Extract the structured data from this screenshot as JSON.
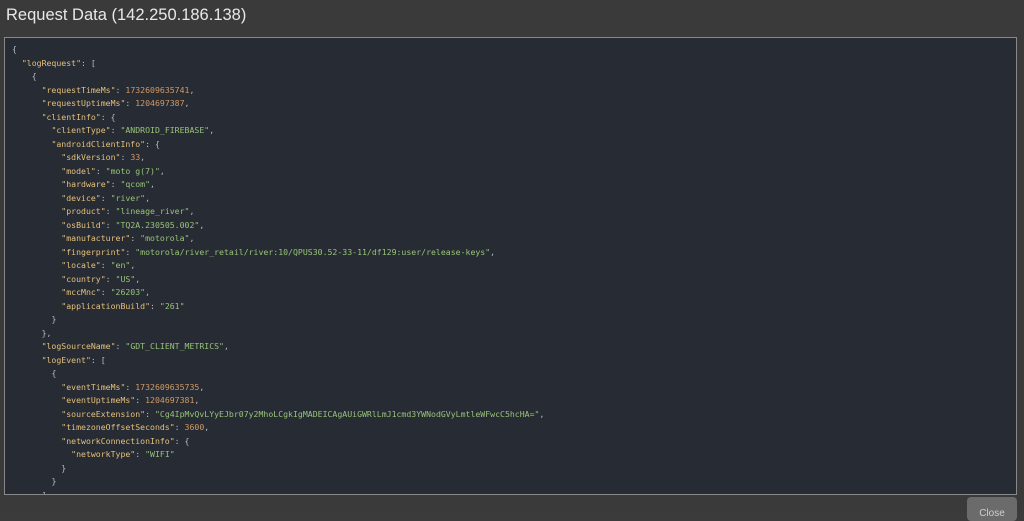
{
  "dialog": {
    "title": "Request Data (142.250.186.138)",
    "close_label": "Close"
  },
  "json_lines": [
    {
      "indent": 0,
      "tokens": [
        {
          "t": "p",
          "v": "{"
        }
      ]
    },
    {
      "indent": 1,
      "tokens": [
        {
          "t": "k",
          "v": "\"logRequest\""
        },
        {
          "t": "p",
          "v": ": ["
        }
      ]
    },
    {
      "indent": 2,
      "tokens": [
        {
          "t": "p",
          "v": "{"
        }
      ]
    },
    {
      "indent": 3,
      "tokens": [
        {
          "t": "k",
          "v": "\"requestTimeMs\""
        },
        {
          "t": "p",
          "v": ": "
        },
        {
          "t": "n",
          "v": "1732609635741"
        },
        {
          "t": "p",
          "v": ","
        }
      ]
    },
    {
      "indent": 3,
      "tokens": [
        {
          "t": "k",
          "v": "\"requestUptimeMs\""
        },
        {
          "t": "p",
          "v": ": "
        },
        {
          "t": "n",
          "v": "1204697387"
        },
        {
          "t": "p",
          "v": ","
        }
      ]
    },
    {
      "indent": 3,
      "tokens": [
        {
          "t": "k",
          "v": "\"clientInfo\""
        },
        {
          "t": "p",
          "v": ": {"
        }
      ]
    },
    {
      "indent": 4,
      "tokens": [
        {
          "t": "k",
          "v": "\"clientType\""
        },
        {
          "t": "p",
          "v": ": "
        },
        {
          "t": "s",
          "v": "\"ANDROID_FIREBASE\""
        },
        {
          "t": "p",
          "v": ","
        }
      ]
    },
    {
      "indent": 4,
      "tokens": [
        {
          "t": "k",
          "v": "\"androidClientInfo\""
        },
        {
          "t": "p",
          "v": ": {"
        }
      ]
    },
    {
      "indent": 5,
      "tokens": [
        {
          "t": "k",
          "v": "\"sdkVersion\""
        },
        {
          "t": "p",
          "v": ": "
        },
        {
          "t": "n",
          "v": "33"
        },
        {
          "t": "p",
          "v": ","
        }
      ]
    },
    {
      "indent": 5,
      "tokens": [
        {
          "t": "k",
          "v": "\"model\""
        },
        {
          "t": "p",
          "v": ": "
        },
        {
          "t": "s",
          "v": "\"moto g(7)\""
        },
        {
          "t": "p",
          "v": ","
        }
      ]
    },
    {
      "indent": 5,
      "tokens": [
        {
          "t": "k",
          "v": "\"hardware\""
        },
        {
          "t": "p",
          "v": ": "
        },
        {
          "t": "s",
          "v": "\"qcom\""
        },
        {
          "t": "p",
          "v": ","
        }
      ]
    },
    {
      "indent": 5,
      "tokens": [
        {
          "t": "k",
          "v": "\"device\""
        },
        {
          "t": "p",
          "v": ": "
        },
        {
          "t": "s",
          "v": "\"river\""
        },
        {
          "t": "p",
          "v": ","
        }
      ]
    },
    {
      "indent": 5,
      "tokens": [
        {
          "t": "k",
          "v": "\"product\""
        },
        {
          "t": "p",
          "v": ": "
        },
        {
          "t": "s",
          "v": "\"lineage_river\""
        },
        {
          "t": "p",
          "v": ","
        }
      ]
    },
    {
      "indent": 5,
      "tokens": [
        {
          "t": "k",
          "v": "\"osBuild\""
        },
        {
          "t": "p",
          "v": ": "
        },
        {
          "t": "s",
          "v": "\"TQ2A.230505.002\""
        },
        {
          "t": "p",
          "v": ","
        }
      ]
    },
    {
      "indent": 5,
      "tokens": [
        {
          "t": "k",
          "v": "\"manufacturer\""
        },
        {
          "t": "p",
          "v": ": "
        },
        {
          "t": "s",
          "v": "\"motorola\""
        },
        {
          "t": "p",
          "v": ","
        }
      ]
    },
    {
      "indent": 5,
      "tokens": [
        {
          "t": "k",
          "v": "\"fingerprint\""
        },
        {
          "t": "p",
          "v": ": "
        },
        {
          "t": "s",
          "v": "\"motorola/river_retail/river:10/QPUS30.52-33-11/df129:user/release-keys\""
        },
        {
          "t": "p",
          "v": ","
        }
      ]
    },
    {
      "indent": 5,
      "tokens": [
        {
          "t": "k",
          "v": "\"locale\""
        },
        {
          "t": "p",
          "v": ": "
        },
        {
          "t": "s",
          "v": "\"en\""
        },
        {
          "t": "p",
          "v": ","
        }
      ]
    },
    {
      "indent": 5,
      "tokens": [
        {
          "t": "k",
          "v": "\"country\""
        },
        {
          "t": "p",
          "v": ": "
        },
        {
          "t": "s",
          "v": "\"US\""
        },
        {
          "t": "p",
          "v": ","
        }
      ]
    },
    {
      "indent": 5,
      "tokens": [
        {
          "t": "k",
          "v": "\"mccMnc\""
        },
        {
          "t": "p",
          "v": ": "
        },
        {
          "t": "s",
          "v": "\"26203\""
        },
        {
          "t": "p",
          "v": ","
        }
      ]
    },
    {
      "indent": 5,
      "tokens": [
        {
          "t": "k",
          "v": "\"applicationBuild\""
        },
        {
          "t": "p",
          "v": ": "
        },
        {
          "t": "s",
          "v": "\"261\""
        }
      ]
    },
    {
      "indent": 4,
      "tokens": [
        {
          "t": "p",
          "v": "}"
        }
      ]
    },
    {
      "indent": 3,
      "tokens": [
        {
          "t": "p",
          "v": "},"
        }
      ]
    },
    {
      "indent": 3,
      "tokens": [
        {
          "t": "k",
          "v": "\"logSourceName\""
        },
        {
          "t": "p",
          "v": ": "
        },
        {
          "t": "s",
          "v": "\"GDT_CLIENT_METRICS\""
        },
        {
          "t": "p",
          "v": ","
        }
      ]
    },
    {
      "indent": 3,
      "tokens": [
        {
          "t": "k",
          "v": "\"logEvent\""
        },
        {
          "t": "p",
          "v": ": ["
        }
      ]
    },
    {
      "indent": 4,
      "tokens": [
        {
          "t": "p",
          "v": "{"
        }
      ]
    },
    {
      "indent": 5,
      "tokens": [
        {
          "t": "k",
          "v": "\"eventTimeMs\""
        },
        {
          "t": "p",
          "v": ": "
        },
        {
          "t": "n",
          "v": "1732609635735"
        },
        {
          "t": "p",
          "v": ","
        }
      ]
    },
    {
      "indent": 5,
      "tokens": [
        {
          "t": "k",
          "v": "\"eventUptimeMs\""
        },
        {
          "t": "p",
          "v": ": "
        },
        {
          "t": "n",
          "v": "1204697381"
        },
        {
          "t": "p",
          "v": ","
        }
      ]
    },
    {
      "indent": 5,
      "tokens": [
        {
          "t": "k",
          "v": "\"sourceExtension\""
        },
        {
          "t": "p",
          "v": ": "
        },
        {
          "t": "s",
          "v": "\"Cg4IpMvQvLYyEJbr07y2MhoLCgkIgMADEICAgAUiGWRlLmJ1cmd3YWNodGVyLmtleWFwcC5hcHA=\""
        },
        {
          "t": "p",
          "v": ","
        }
      ]
    },
    {
      "indent": 5,
      "tokens": [
        {
          "t": "k",
          "v": "\"timezoneOffsetSeconds\""
        },
        {
          "t": "p",
          "v": ": "
        },
        {
          "t": "n",
          "v": "3600"
        },
        {
          "t": "p",
          "v": ","
        }
      ]
    },
    {
      "indent": 5,
      "tokens": [
        {
          "t": "k",
          "v": "\"networkConnectionInfo\""
        },
        {
          "t": "p",
          "v": ": {"
        }
      ]
    },
    {
      "indent": 6,
      "tokens": [
        {
          "t": "k",
          "v": "\"networkType\""
        },
        {
          "t": "p",
          "v": ": "
        },
        {
          "t": "s",
          "v": "\"WIFI\""
        }
      ]
    },
    {
      "indent": 5,
      "tokens": [
        {
          "t": "p",
          "v": "}"
        }
      ]
    },
    {
      "indent": 4,
      "tokens": [
        {
          "t": "p",
          "v": "}"
        }
      ]
    },
    {
      "indent": 3,
      "tokens": [
        {
          "t": "p",
          "v": "]"
        }
      ]
    }
  ]
}
